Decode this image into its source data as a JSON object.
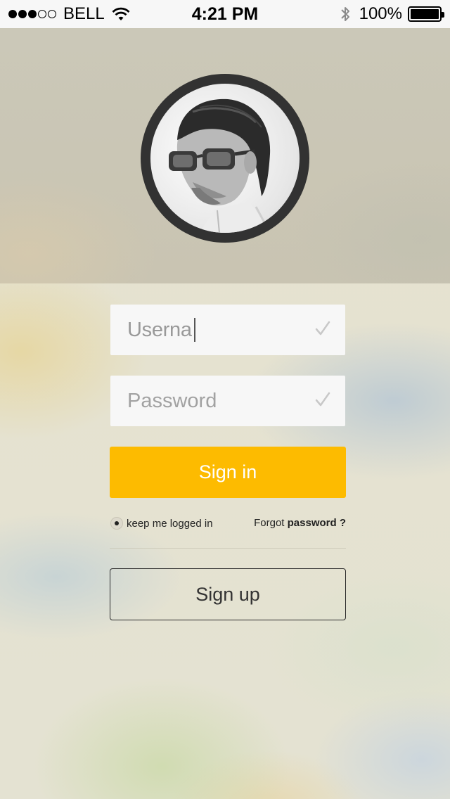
{
  "status_bar": {
    "signal_dots": [
      true,
      true,
      true,
      false,
      false
    ],
    "carrier": "BELL",
    "time": "4:21 PM",
    "battery_percent": "100%",
    "icons": [
      "wifi-icon",
      "bluetooth-icon",
      "battery-icon"
    ]
  },
  "avatar": {
    "icon": "profile-photo"
  },
  "login_form": {
    "username_value": "Userna",
    "username_icon": "checkmark-icon",
    "password_placeholder": "Password",
    "password_icon": "checkmark-icon",
    "sign_in_label": "Sign in",
    "keep_logged_in_label": "keep me logged in",
    "keep_logged_in_checked": true,
    "forgot_prefix": "Forgot",
    "forgot_link": "password ?",
    "sign_up_label": "Sign up"
  },
  "colors": {
    "accent": "#fdbb00",
    "avatar_ring": "#323232",
    "field_bg": "#f7f7f7"
  }
}
